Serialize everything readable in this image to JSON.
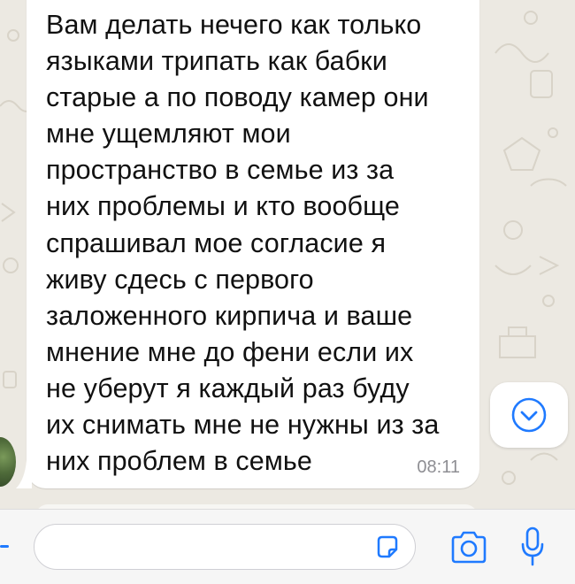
{
  "chat": {
    "message": {
      "lines": [
        "Вам делать нечего как только",
        "языками трипать как бабки",
        "старые а по поводу камер они",
        "мне ущемляют мои",
        "пространство в семье из за",
        "них проблемы и кто вообще",
        "спрашивал мое согласие я",
        "живу сдесь с первого",
        "заложенного кирпича и ваше",
        "мнение мне до фени если их",
        "не уберут я каждый раз буду",
        "их снимать мне не нужны из за",
        "них проблем в семье"
      ],
      "time": "08:11"
    }
  },
  "input": {
    "placeholder": ""
  },
  "icons": {
    "scroll": "chevron-down-icon",
    "sticker": "sticker-icon",
    "camera": "camera-icon",
    "mic": "microphone-icon"
  },
  "colors": {
    "accent": "#1f7aff",
    "bubble": "#ffffff",
    "wallpaper": "#ece9e2"
  }
}
